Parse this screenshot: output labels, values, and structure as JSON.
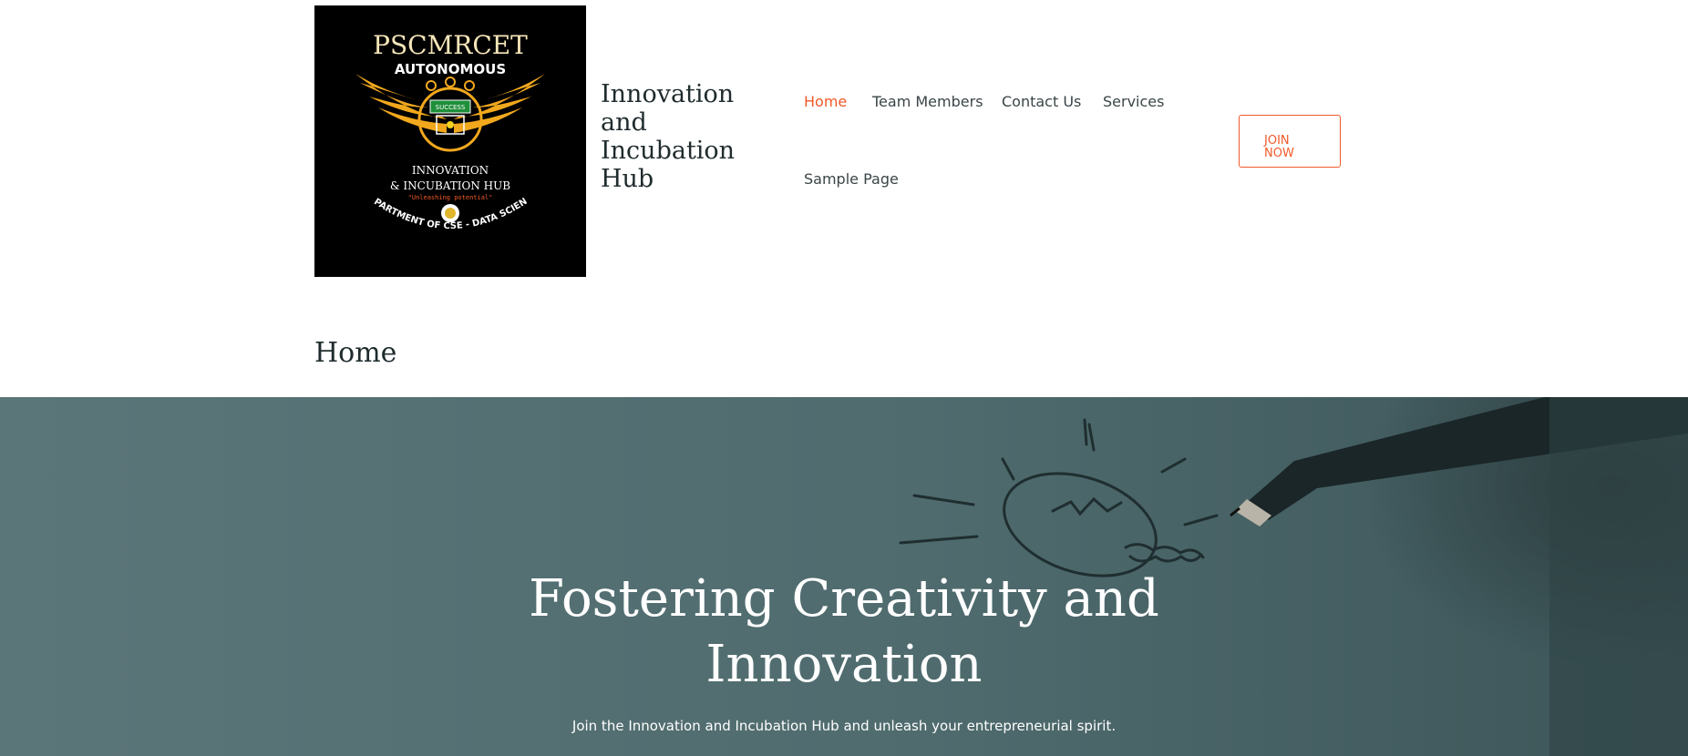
{
  "logo": {
    "line1": "PSCMRCET",
    "line2": "AUTONOMOUS",
    "badge": "SUCCESS",
    "line3": "INNOVATION",
    "line4": "& INCUBATION HUB",
    "tagline": "\"Unleashing potential\"",
    "arc": "DEPARTMENT OF CSE - DATA SCIENCE"
  },
  "site": {
    "title": "Innovation\nand\nIncubation\nHub"
  },
  "nav": {
    "items": [
      "Home",
      "Team Members",
      "Contact Us",
      "Services",
      "Sample Page"
    ],
    "active": "Home"
  },
  "cta": {
    "label": "JOIN\nNOW"
  },
  "page": {
    "title": "Home"
  },
  "hero": {
    "heading": "Fostering Creativity and\nInnovation",
    "subtext": "Join the Innovation and Incubation Hub and unleash your entrepreneurial spirit."
  },
  "colors": {
    "accent": "#f05a28",
    "hero_overlay": "#4f6b6e",
    "text_dark": "#1f2b2d",
    "logo_gold": "#f2a81d"
  }
}
